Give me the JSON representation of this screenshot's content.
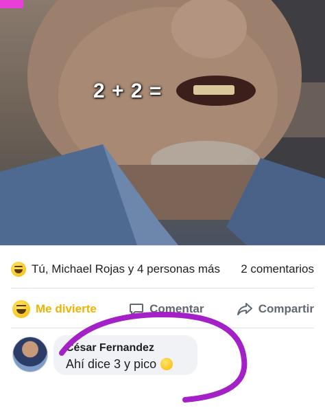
{
  "meme": {
    "text": "2 + 2 ="
  },
  "reactions": {
    "summary": "Tú, Michael Rojas y 4 personas más",
    "comments_count": "2 comentarios"
  },
  "actions": {
    "reaction_label": "Me divierte",
    "comment_label": "Comentar",
    "share_label": "Compartir"
  },
  "comment": {
    "author": "César Fernandez",
    "text": "Ahí dice 3 y pico"
  },
  "colors": {
    "reaction_active": "#f0b400",
    "highlight_circle": "#a321c7",
    "pink_marker": "#e83fd8"
  },
  "icons": {
    "laugh": "laughing-emoji-icon",
    "comment": "speech-bubble-icon",
    "share": "share-arrow-icon",
    "thinking": "thinking-emoji-icon"
  }
}
